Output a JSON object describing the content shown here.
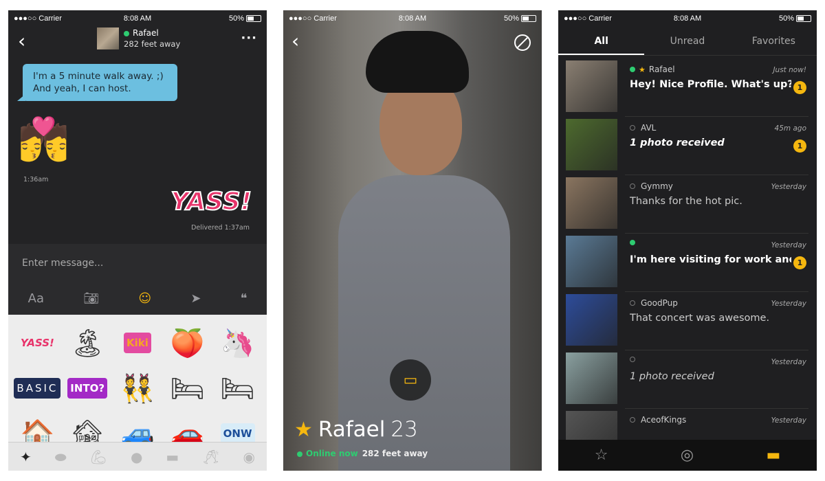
{
  "status_bar": {
    "signal": "●●●○○",
    "carrier": "Carrier",
    "time": "8:08 AM",
    "battery": "50%"
  },
  "chat": {
    "contact_name": "Rafael",
    "contact_distance": "282 feet away",
    "online_color": "#2ecc71",
    "messages": [
      {
        "from": "them",
        "text_line1": "I'm a 5 minute walk away. ;)",
        "text_line2": "And yeah, I can host."
      },
      {
        "from": "them",
        "sticker": "💏",
        "time": "1:36am"
      },
      {
        "from": "me",
        "sticker": "YASS!",
        "status": "Delivered 1:37am"
      }
    ],
    "input_placeholder": "Enter message...",
    "toolbar": {
      "text": "Aa",
      "camera": "camera-icon",
      "emoji": "smiley-icon",
      "location": "location-arrow-icon",
      "phrases": "saved-phrases-icon"
    },
    "stickers": [
      "YASS!",
      "🏝",
      "Kiki",
      "🍑",
      "🦄",
      "BASIC",
      "INTO?",
      "👯",
      "🛏",
      "🛏",
      "🏠",
      "🏚",
      "🚙",
      "🚗",
      "ONW"
    ],
    "sticker_categories": [
      "sparkles-icon",
      "eggplant-icon",
      "muscle-icon",
      "head-icon",
      "bed-icon",
      "cheers-icon",
      "mask-icon"
    ]
  },
  "profile": {
    "name": "Rafael",
    "age": "23",
    "status": "Online now",
    "distance": "282 feet away",
    "favorite": true
  },
  "inbox": {
    "tabs": [
      "All",
      "Unread",
      "Favorites"
    ],
    "active_tab": "All",
    "rows": [
      {
        "name": "Rafael",
        "online": true,
        "favorite": true,
        "time": "Just now!",
        "message": "Hey! Nice Profile. What's up?",
        "unread": true,
        "badge": "1",
        "photo": "#8a7f72"
      },
      {
        "name": "AVL",
        "online": false,
        "time": "45m ago",
        "message": "1 photo received",
        "unread": true,
        "italic": true,
        "badge": "1",
        "photo": "#4d6a2e"
      },
      {
        "name": "Gymmy",
        "online": false,
        "time": "Yesterday",
        "message": "Thanks for the hot pic.",
        "photo": "#8a7560"
      },
      {
        "name": "",
        "online": true,
        "time": "Yesterday",
        "message": "I'm here visiting for work and...",
        "unread": true,
        "badge": "1",
        "photo": "#5a7a95"
      },
      {
        "name": "GoodPup",
        "online": false,
        "time": "Yesterday",
        "message": "That concert was awesome.",
        "photo": "#2d4c9a"
      },
      {
        "name": "",
        "online": false,
        "time": "Yesterday",
        "message": "1 photo received",
        "italic": true,
        "photo": "#8aa0a0"
      },
      {
        "name": "AceofKings",
        "online": false,
        "time": "Yesterday",
        "message": "",
        "photo": "#555"
      }
    ],
    "nav": [
      "star-icon",
      "mask-icon",
      "chat-icon"
    ],
    "active_nav": "chat-icon",
    "accent": "#f5b70f"
  }
}
